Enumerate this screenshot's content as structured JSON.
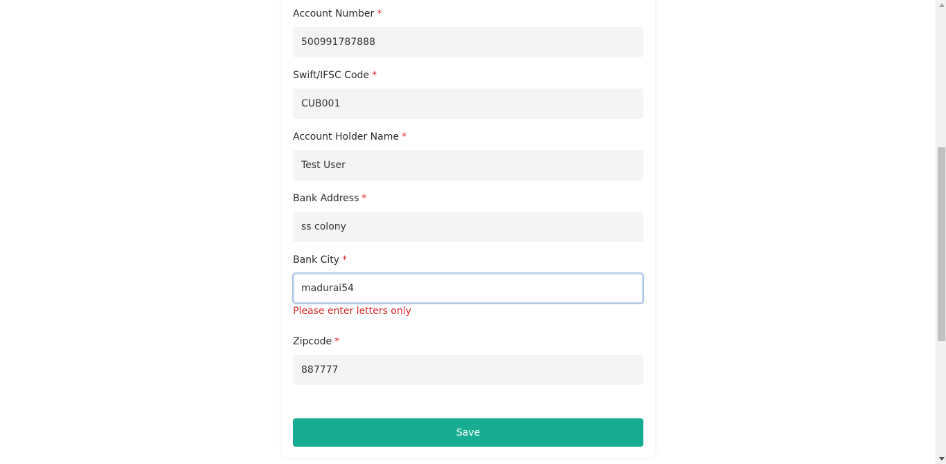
{
  "form": {
    "fields": [
      {
        "label": "Account Number",
        "required_mark": "*",
        "value": "500991787888"
      },
      {
        "label": "Swift/IFSC Code",
        "required_mark": "*",
        "value": "CUB001"
      },
      {
        "label": "Account Holder Name",
        "required_mark": "*",
        "value": "Test User"
      },
      {
        "label": "Bank Address",
        "required_mark": "*",
        "value": "ss colony"
      },
      {
        "label": "Bank City",
        "required_mark": "*",
        "value": "madurai54",
        "error": "Please enter letters only"
      },
      {
        "label": "Zipcode",
        "required_mark": "*",
        "value": "887777"
      }
    ],
    "save_label": "Save"
  },
  "colors": {
    "accent": "#18ad92",
    "error": "#e02424",
    "input_bg": "#f4f4f4"
  }
}
